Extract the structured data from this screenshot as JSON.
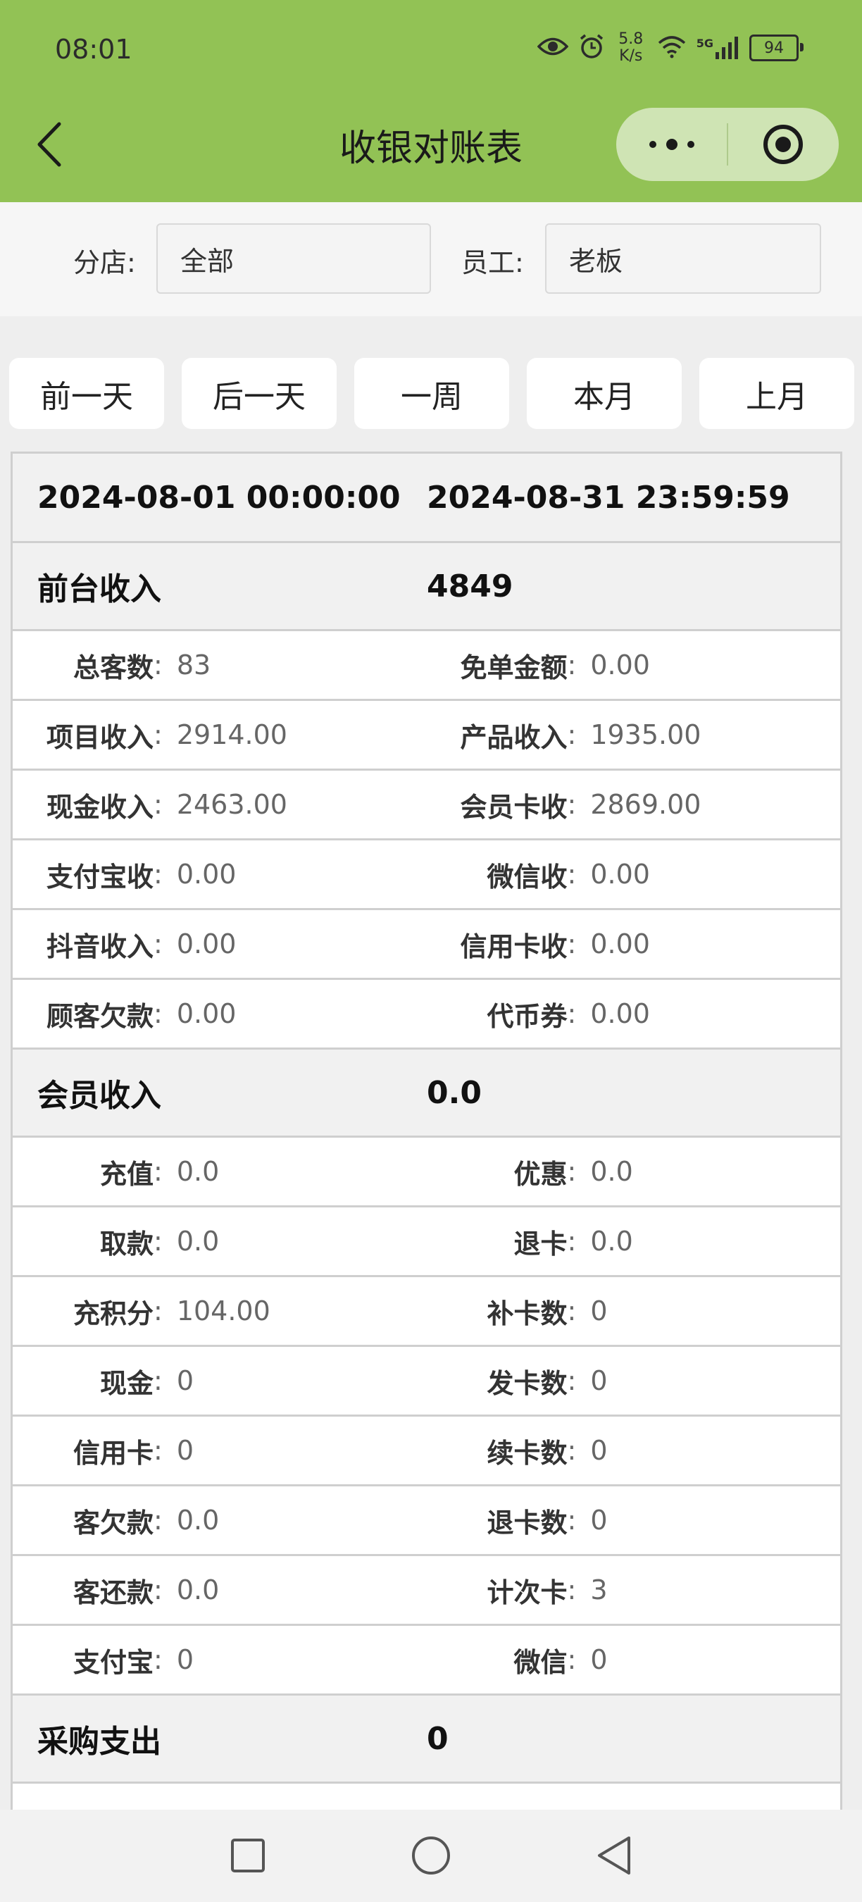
{
  "status": {
    "time": "08:01",
    "net_speed_value": "5.8",
    "net_speed_unit": "K/s",
    "signal": "5G",
    "battery": "94"
  },
  "nav": {
    "title": "收银对账表"
  },
  "filters": {
    "branch_label": "分店:",
    "branch_value": "全部",
    "staff_label": "员工:",
    "staff_value": "老板"
  },
  "quick_buttons": [
    "前一天",
    "后一天",
    "一周",
    "本月",
    "上月"
  ],
  "range": {
    "start": "2024-08-01 00:00:00",
    "end": "2024-08-31 23:59:59"
  },
  "front": {
    "title": "前台收入",
    "total": "4849",
    "rows": [
      [
        {
          "label": "总客数",
          "value": "83"
        },
        {
          "label": "免单金额",
          "value": "0.00"
        }
      ],
      [
        {
          "label": "项目收入",
          "value": "2914.00"
        },
        {
          "label": "产品收入",
          "value": "1935.00"
        }
      ],
      [
        {
          "label": "现金收入",
          "value": "2463.00"
        },
        {
          "label": "会员卡收",
          "value": "2869.00"
        }
      ],
      [
        {
          "label": "支付宝收",
          "value": "0.00"
        },
        {
          "label": "微信收",
          "value": "0.00"
        }
      ],
      [
        {
          "label": "抖音收入",
          "value": "0.00"
        },
        {
          "label": "信用卡收",
          "value": "0.00"
        }
      ],
      [
        {
          "label": "顾客欠款",
          "value": "0.00"
        },
        {
          "label": "代币券",
          "value": "0.00"
        }
      ]
    ]
  },
  "member": {
    "title": "会员收入",
    "total": "0.0",
    "rows": [
      [
        {
          "label": "充值",
          "value": "0.0"
        },
        {
          "label": "优惠",
          "value": "0.0"
        }
      ],
      [
        {
          "label": "取款",
          "value": "0.0"
        },
        {
          "label": "退卡",
          "value": "0.0"
        }
      ],
      [
        {
          "label": "充积分",
          "value": "104.00"
        },
        {
          "label": "补卡数",
          "value": "0"
        }
      ],
      [
        {
          "label": "现金",
          "value": "0"
        },
        {
          "label": "发卡数",
          "value": "0"
        }
      ],
      [
        {
          "label": "信用卡",
          "value": "0"
        },
        {
          "label": "续卡数",
          "value": "0"
        }
      ],
      [
        {
          "label": "客欠款",
          "value": "0.0"
        },
        {
          "label": "退卡数",
          "value": "0"
        }
      ],
      [
        {
          "label": "客还款",
          "value": "0.0"
        },
        {
          "label": "计次卡",
          "value": "3"
        }
      ],
      [
        {
          "label": "支付宝",
          "value": "0"
        },
        {
          "label": "微信",
          "value": "0"
        }
      ]
    ]
  },
  "purchase": {
    "title": "采购支出",
    "total": "0"
  },
  "separator": ":",
  "colors": {
    "header_green": "#92c255",
    "capsule": "#cfe4b4"
  }
}
